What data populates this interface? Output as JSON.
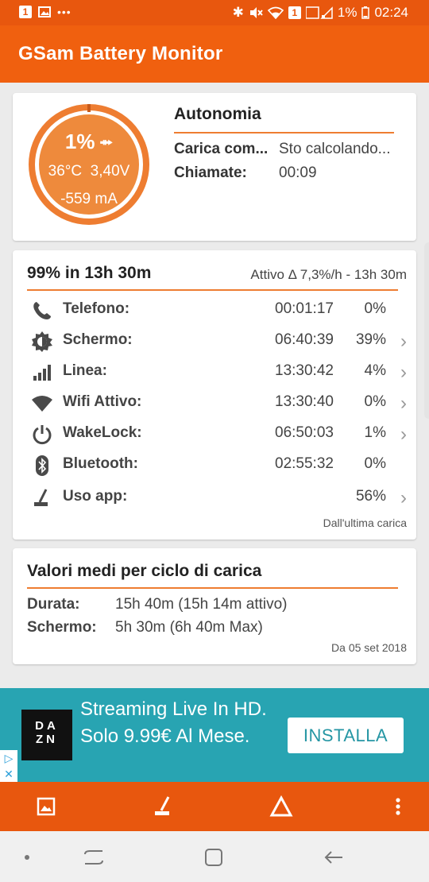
{
  "status_bar": {
    "badge": "1",
    "battery_pct": "1%",
    "badge2": "1",
    "time": "02:24"
  },
  "app_bar": {
    "title": "GSam Battery Monitor"
  },
  "battery_card": {
    "percent": "1%",
    "level_fraction": 0.01,
    "temperature": "36°C",
    "voltage": "3,40V",
    "current": "-559 mA",
    "autonomy_title": "Autonomia",
    "rows": [
      {
        "key": "Carica com...",
        "value": "Sto calcolando..."
      },
      {
        "key": "Chiamate:",
        "value": "00:09"
      }
    ],
    "gauge_color": "#ee8a3c"
  },
  "usage_card": {
    "title": "99% in 13h 30m",
    "subtitle": "Attivo Δ 7,3%/h - 13h 30m",
    "rows": [
      {
        "icon": "phone-icon",
        "label": "Telefono:",
        "time": "00:01:17",
        "pct": "0%"
      },
      {
        "icon": "screen-brightness-icon",
        "label": "Schermo:",
        "time": "06:40:39",
        "pct": "39%"
      },
      {
        "icon": "signal-icon",
        "label": "Linea:",
        "time": "13:30:42",
        "pct": "4%"
      },
      {
        "icon": "wifi-icon",
        "label": "Wifi Attivo:",
        "time": "13:30:40",
        "pct": "0%"
      },
      {
        "icon": "power-icon",
        "label": "WakeLock:",
        "time": "06:50:03",
        "pct": "1%"
      },
      {
        "icon": "bluetooth-icon",
        "label": "Bluetooth:",
        "time": "02:55:32",
        "pct": "0%"
      },
      {
        "icon": "app-usage-icon",
        "label": "Uso app:",
        "time": "",
        "pct": "56%"
      }
    ],
    "footer": "Dall'ultima carica"
  },
  "averages_card": {
    "title": "Valori medi per ciclo di carica",
    "rows": [
      {
        "key": "Durata:",
        "value": "15h 40m (15h 14m attivo)"
      },
      {
        "key": "Schermo:",
        "value": "5h 30m (6h 40m Max)"
      }
    ],
    "footer": "Da 05 set 2018"
  },
  "ad": {
    "logo_line1": "DA",
    "logo_line2": "ZN",
    "text": "Streaming Live In HD. Solo 9.99€ Al Mese.",
    "button": "INSTALLA"
  },
  "colors": {
    "accent": "#f0600f",
    "accent_dark": "#e8570e",
    "divider": "#ee7d31",
    "ad_bg": "#28a4b2"
  }
}
